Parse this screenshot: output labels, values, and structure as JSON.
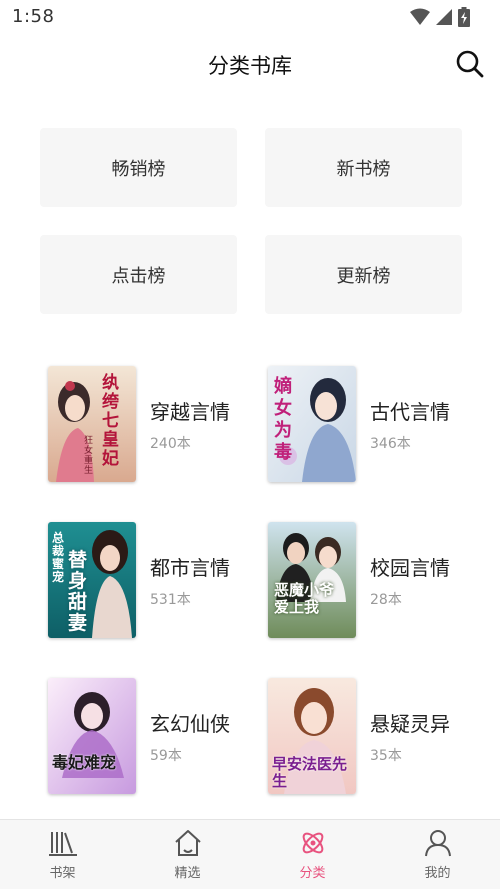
{
  "status_bar": {
    "time": "1:58"
  },
  "header": {
    "title": "分类书库"
  },
  "rankings": [
    {
      "label": "畅销榜"
    },
    {
      "label": "新书榜"
    },
    {
      "label": "点击榜"
    },
    {
      "label": "更新榜"
    }
  ],
  "categories": [
    {
      "name": "穿越言情",
      "count": "240本",
      "cover_title": "纨绔七皇妃",
      "cover_sub": "狂女重生"
    },
    {
      "name": "古代言情",
      "count": "346本",
      "cover_title": "嫡女为毒",
      "cover_sub": ""
    },
    {
      "name": "都市言情",
      "count": "531本",
      "cover_title": "替身甜妻",
      "cover_sub": "总裁蜜宠"
    },
    {
      "name": "校园言情",
      "count": "28本",
      "cover_title": "恶魔小爷爱上我",
      "cover_sub": ""
    },
    {
      "name": "玄幻仙侠",
      "count": "59本",
      "cover_title": "毒妃难宠",
      "cover_sub": ""
    },
    {
      "name": "悬疑灵异",
      "count": "35本",
      "cover_title": "早安法医先生",
      "cover_sub": ""
    }
  ],
  "bottom_nav": [
    {
      "label": "书架",
      "icon": "bookshelf-icon"
    },
    {
      "label": "精选",
      "icon": "home-icon"
    },
    {
      "label": "分类",
      "icon": "category-icon",
      "active": true
    },
    {
      "label": "我的",
      "icon": "profile-icon"
    }
  ],
  "colors": {
    "accent": "#e8537f",
    "tile_bg": "#f6f6f6",
    "count_gray": "#999999"
  }
}
